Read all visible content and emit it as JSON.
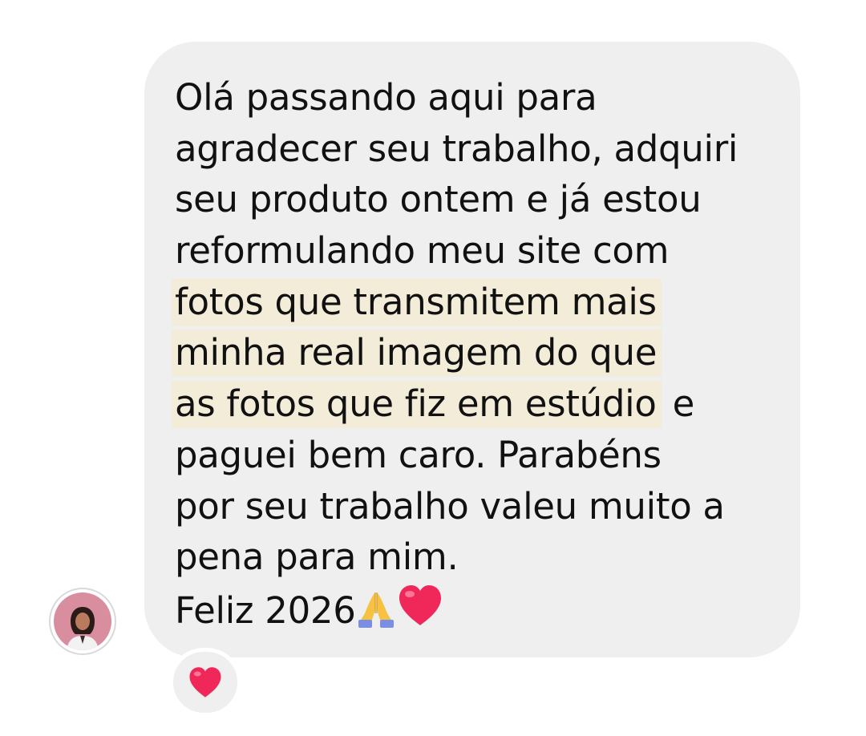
{
  "message": {
    "lines": [
      "Olá passando aqui para",
      "agradecer seu trabalho, adquiri",
      "seu produto ontem e já estou",
      "reformulando meu site com",
      "fotos que transmitem mais",
      "minha real imagem do que",
      "as fotos que fiz em estúdio",
      " e",
      "paguei bem caro. Parabéns",
      "por seu trabalho valeu muito a",
      "pena para mim.",
      "Feliz 2026"
    ],
    "emojis": [
      "praying-hands-icon",
      "red-heart-icon"
    ]
  },
  "reaction": {
    "emoji": "red-heart-icon"
  },
  "colors": {
    "bubble": "#efefef",
    "highlight": "#f2ecd9",
    "text": "#111111",
    "heart": "#f0285a"
  }
}
